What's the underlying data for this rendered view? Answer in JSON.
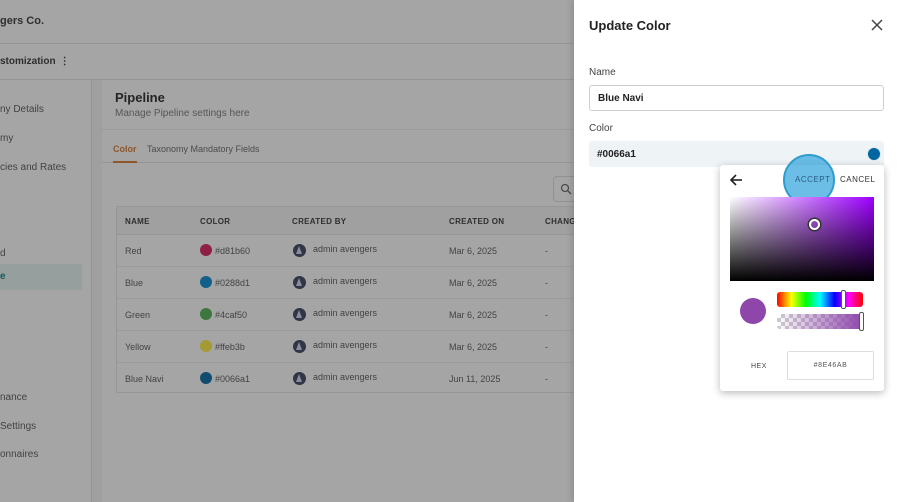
{
  "app": {
    "company_name": "gers Co.",
    "section_title": "stomization",
    "kebab_glyph": "⋮"
  },
  "sidebar": {
    "items": [
      {
        "label": "ny Details",
        "active": false
      },
      {
        "label": "my",
        "active": false
      },
      {
        "label": "cies and Rates",
        "active": false
      },
      {
        "label": "d",
        "active": false
      },
      {
        "label": "e",
        "active": true
      },
      {
        "label": "nance",
        "active": false
      },
      {
        "label": " Settings",
        "active": false
      },
      {
        "label": "onnaires",
        "active": false
      }
    ]
  },
  "page": {
    "title": "Pipeline",
    "subtitle": "Manage Pipeline settings here",
    "tabs": [
      {
        "label": "Color",
        "active": true
      },
      {
        "label": "Taxonomy Mandatory Fields",
        "active": false
      }
    ]
  },
  "table": {
    "headers": [
      "NAME",
      "COLOR",
      "CREATED BY",
      "CREATED ON",
      "CHANG"
    ],
    "rows": [
      {
        "name": "Red",
        "color_hex": "#d81b60",
        "created_by": "admin avengers",
        "created_on": "Mar 6, 2025",
        "changed": "-"
      },
      {
        "name": "Blue",
        "color_hex": "#0288d1",
        "created_by": "admin avengers",
        "created_on": "Mar 6, 2025",
        "changed": "-"
      },
      {
        "name": "Green",
        "color_hex": "#4caf50",
        "created_by": "admin avengers",
        "created_on": "Mar 6, 2025",
        "changed": "-"
      },
      {
        "name": "Yellow",
        "color_hex": "#ffeb3b",
        "created_by": "admin avengers",
        "created_on": "Mar 6, 2025",
        "changed": "-"
      },
      {
        "name": "Blue Navi",
        "color_hex": "#0066a1",
        "created_by": "admin avengers",
        "created_on": "Jun 11, 2025",
        "changed": "-"
      }
    ]
  },
  "drawer": {
    "title": "Update Color",
    "name_label": "Name",
    "name_value": "Blue Navi",
    "color_label": "Color",
    "color_value": "#0066a1",
    "current_color": "#0066a1"
  },
  "picker": {
    "accept_label": "ACCEPT",
    "cancel_label": "CANCEL",
    "hex_label": "HEX",
    "hex_value": "#8E46AB",
    "selected_color": "#8E46AB"
  },
  "colors": {
    "accent_orange": "#d9772a",
    "active_teal": "#0b7f84",
    "accept_halo": "#3ba8de"
  },
  "icons": [
    "kebab-icon",
    "search-icon",
    "close-icon",
    "back-arrow-icon",
    "avatar-icon"
  ]
}
